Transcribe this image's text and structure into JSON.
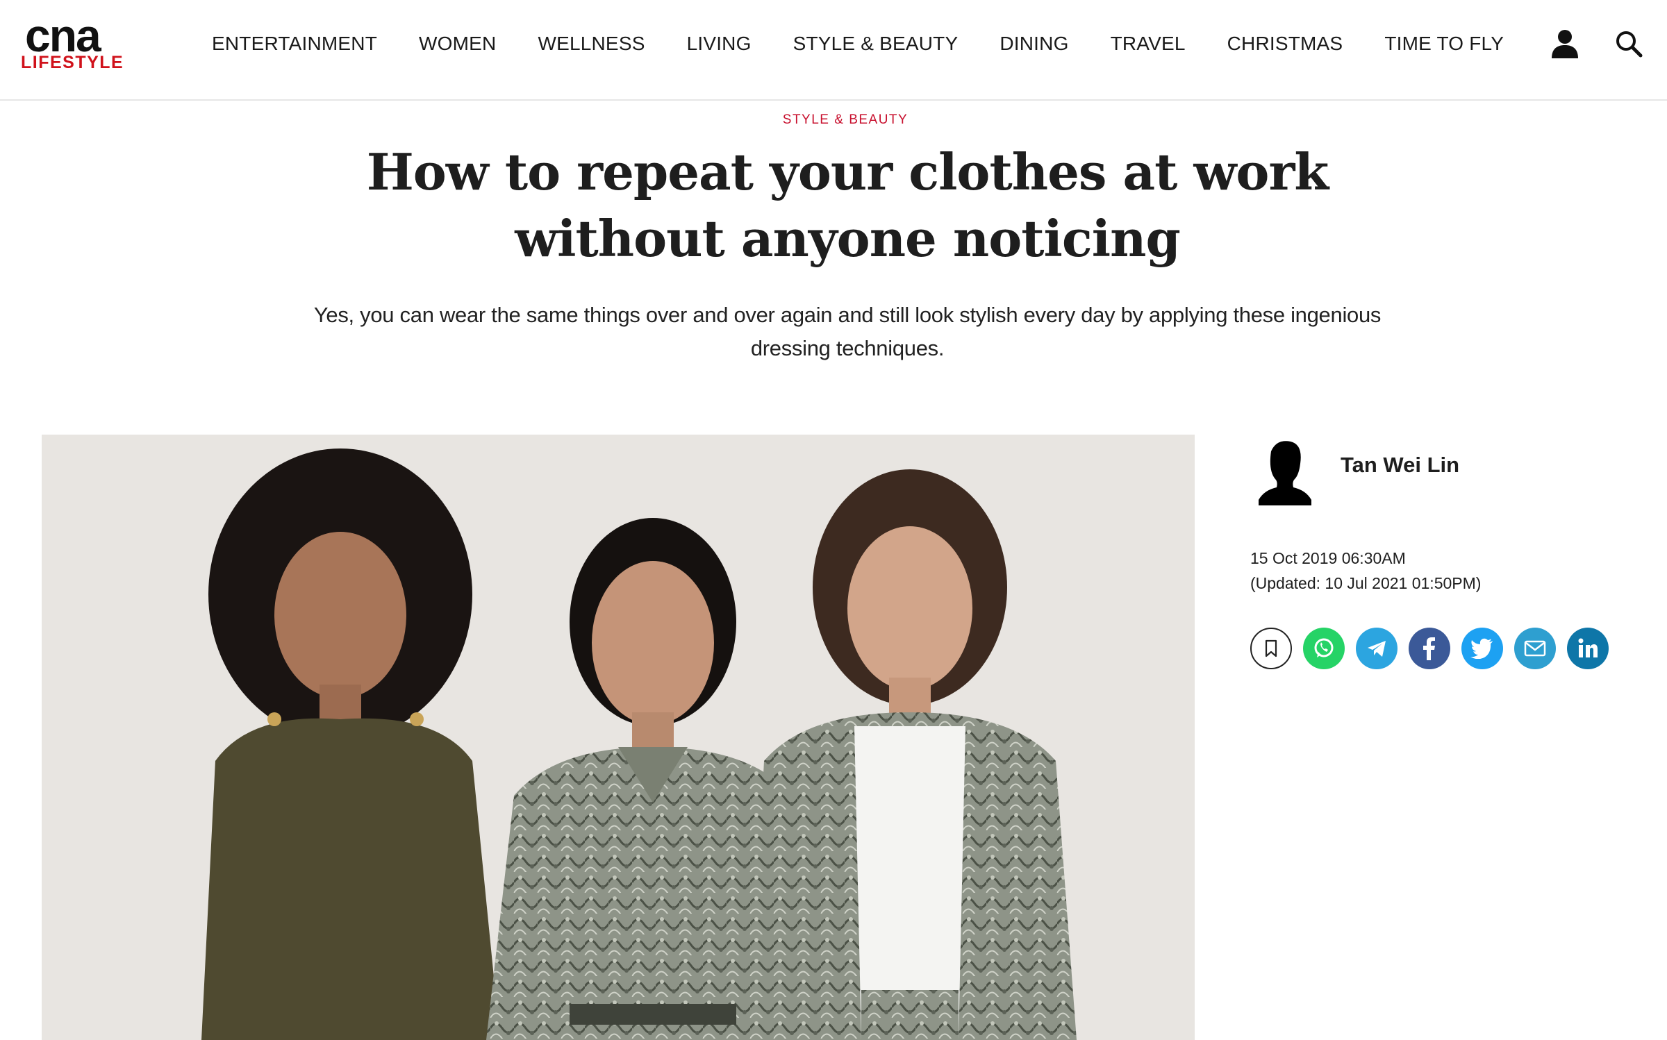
{
  "header": {
    "logo_top": "cna",
    "logo_bottom": "LIFESTYLE",
    "nav": [
      {
        "label": "ENTERTAINMENT"
      },
      {
        "label": "WOMEN"
      },
      {
        "label": "WELLNESS"
      },
      {
        "label": "LIVING"
      },
      {
        "label": "STYLE & BEAUTY"
      },
      {
        "label": "DINING"
      },
      {
        "label": "TRAVEL"
      },
      {
        "label": "CHRISTMAS"
      },
      {
        "label": "TIME TO FLY"
      }
    ],
    "icons": [
      "user-icon",
      "search-icon"
    ]
  },
  "article": {
    "category": "STYLE & BEAUTY",
    "title": "How to repeat your clothes at work without anyone noticing",
    "subtitle": "Yes, you can wear the same things over and over again and still look stylish every day by applying these ingenious dressing techniques."
  },
  "sidebar": {
    "author": "Tan Wei Lin",
    "published": "15 Oct 2019 06:30AM",
    "updated": "(Updated: 10 Jul 2021 01:50PM)",
    "share": [
      {
        "name": "bookmark-icon"
      },
      {
        "name": "whatsapp-icon"
      },
      {
        "name": "telegram-icon"
      },
      {
        "name": "facebook-icon"
      },
      {
        "name": "twitter-icon"
      },
      {
        "name": "email-icon"
      },
      {
        "name": "linkedin-icon"
      }
    ]
  },
  "colors": {
    "brand_red": "#d0121b",
    "category_red": "#c8102e",
    "whatsapp": "#25d366",
    "telegram": "#2ca5e0",
    "facebook": "#3b5998",
    "twitter": "#1da1f2",
    "email": "#2e9fd0",
    "linkedin": "#0e76a8"
  }
}
